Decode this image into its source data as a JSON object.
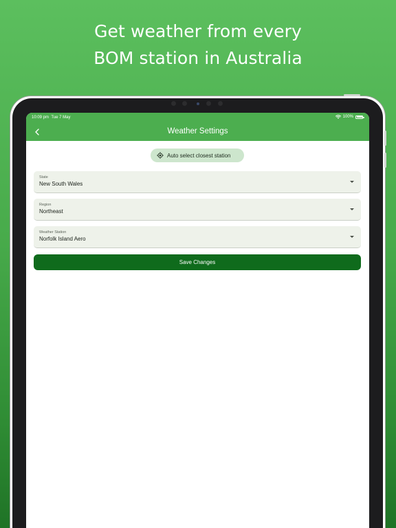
{
  "promo": {
    "headline_line1": "Get weather from every",
    "headline_line2": "BOM station in Australia"
  },
  "status_bar": {
    "time": "10:09 pm",
    "date": "Tue 7 May",
    "battery": "100%"
  },
  "app_bar": {
    "title": "Weather Settings"
  },
  "auto_select": {
    "label": "Auto select closest station"
  },
  "fields": {
    "state": {
      "label": "State",
      "value": "New South Wales"
    },
    "region": {
      "label": "Region",
      "value": "Northeast"
    },
    "station": {
      "label": "Weather Station",
      "value": "Norfolk Island Aero"
    }
  },
  "save": {
    "label": "Save Changes"
  },
  "colors": {
    "background_top": "#5cbf5e",
    "background_bottom": "#1f7326",
    "app_bar": "#4cae4f",
    "chip": "#cde6cd",
    "field": "#eef2ea",
    "save_button": "#0f6b1c"
  },
  "icons": {
    "back": "chevron-left-icon",
    "location": "gps-target-icon",
    "dropdown": "triangle-down-icon",
    "wifi": "wifi-icon",
    "battery": "battery-icon"
  }
}
